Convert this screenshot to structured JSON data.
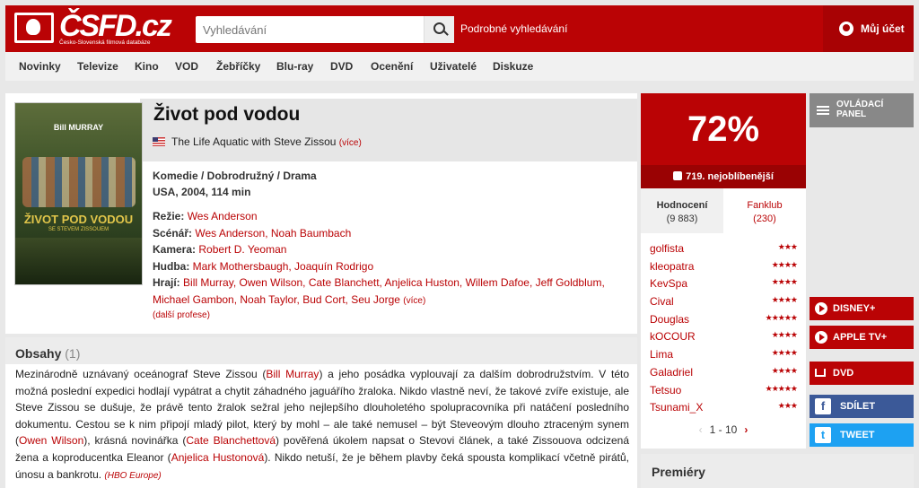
{
  "header": {
    "logo_text": "ČSFD.cz",
    "logo_sub": "Česko-Slovenská filmová databáze",
    "search_placeholder": "Vyhledávání",
    "advanced_search": "Podrobné vyhledávání",
    "account": "Můj účet"
  },
  "nav": [
    "Novinky",
    "Televize",
    "Kino",
    "VOD",
    "Žebříčky",
    "Blu-ray",
    "DVD",
    "Ocenění",
    "Uživatelé",
    "Diskuze"
  ],
  "poster": {
    "top_text": "Bill MURRAY",
    "title_text": "ŽIVOT POD VODOU",
    "sub_text": "SE STEVEM ZISSOUEM"
  },
  "film": {
    "title": "Život pod vodou",
    "original_title": "The Life Aquatic with Steve Zissou",
    "more": "(více)",
    "genres": "Komedie / Dobrodružný / Drama",
    "origin": "USA, 2004, 114 min",
    "director_label": "Režie:",
    "director": "Wes Anderson",
    "writers_label": "Scénář:",
    "writers": "Wes Anderson, Noah Baumbach",
    "camera_label": "Kamera:",
    "camera": "Robert D. Yeoman",
    "music_label": "Hudba:",
    "music": "Mark Mothersbaugh, Joaquín Rodrigo",
    "cast_label": "Hrají:",
    "cast": "Bill Murray, Owen Wilson, Cate Blanchett, Anjelica Huston, Willem Dafoe, Jeff Goldblum, Michael Gambon, Noah Taylor, Bud Cort, Seu Jorge",
    "cast_more": "(více)",
    "more_professions": "(další profese)"
  },
  "plot": {
    "title": "Obsahy",
    "count": "(1)",
    "p1": "Mezinárodně uznávaný oceánograf Steve Zissou (",
    "l1": "Bill Murray",
    "p2": ") a jeho posádka vyplouvají za dalším dobrodružstvím. V této možná poslední expedici hodlají vypátrat a chytit záhadného jaguářího žraloka. Nikdo vlastně neví, že takové zvíře existuje, ale Steve Zissou se dušuje, že právě tento žralok sežral jeho nejlepšího dlouholetého spolupracovníka při natáčení posledního dokumentu. Cestou se k nim připojí mladý pilot, který by mohl – ale také nemusel – být Steveovým dlouho ztraceným synem (",
    "l2": "Owen Wilson",
    "p3": "), krásná novinářka (",
    "l3": "Cate Blanchettová",
    "p4": ") pověřená úkolem napsat o Stevovi článek, a také Zissouova odcizená žena a koproducentka Eleanor (",
    "l4": "Anjelica Hustonová",
    "p5": "). Nikdo netuší, že je během plavby čeká spousta komplikací včetně pirátů, únosu a bankrotu. ",
    "source": "(HBO Europe)"
  },
  "rating": {
    "value": "72%",
    "rank": "719. nejoblíbenější",
    "tab1_label": "Hodnocení",
    "tab1_count": "(9 883)",
    "tab2_label": "Fanklub",
    "tab2_count": "(230)",
    "users": [
      {
        "name": "golfista",
        "stars": "★★★"
      },
      {
        "name": "kleopatra",
        "stars": "★★★★"
      },
      {
        "name": "KevSpa",
        "stars": "★★★★"
      },
      {
        "name": "Cival",
        "stars": "★★★★"
      },
      {
        "name": "Douglas",
        "stars": "★★★★★"
      },
      {
        "name": "kOCOUR",
        "stars": "★★★★"
      },
      {
        "name": "Lima",
        "stars": "★★★★"
      },
      {
        "name": "Galadriel",
        "stars": "★★★★"
      },
      {
        "name": "Tetsuo",
        "stars": "★★★★★"
      },
      {
        "name": "Tsunami_X",
        "stars": "★★★"
      }
    ],
    "pager": "1 - 10",
    "prev": "‹",
    "next": "›"
  },
  "side": {
    "control_panel": "OVLÁDACÍ PANEL",
    "disney": "DISNEY+",
    "appletv": "APPLE TV+",
    "dvd": "DVD",
    "share": "SDÍLET",
    "tweet": "TWEET",
    "fb_icon": "f",
    "tw_icon": "t"
  },
  "premiery": "Premiéry",
  "colors": {
    "brand": "#ba0305",
    "facebook": "#3b5998",
    "twitter": "#1da1f2"
  }
}
